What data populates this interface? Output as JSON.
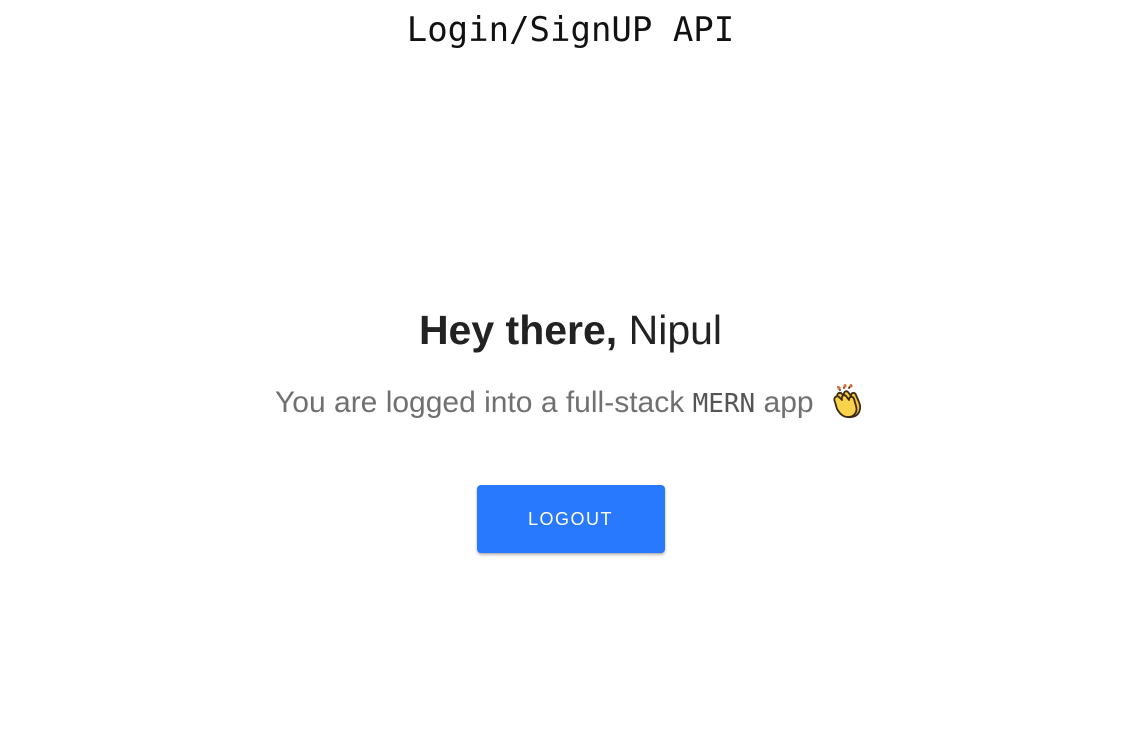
{
  "header": {
    "title": "Login/SignUP API"
  },
  "main": {
    "greeting_prefix": "Hey there,",
    "user_name": "Nipul",
    "subtitle_before": "You are logged into a full-stack",
    "subtitle_code": "MERN",
    "subtitle_after": "app",
    "subtitle_icon": "clapping-hands-icon"
  },
  "actions": {
    "logout_label": "LOGOUT"
  },
  "colors": {
    "accent": "#2979ff",
    "subtitle_text": "#707070",
    "heading_text": "#222222"
  }
}
